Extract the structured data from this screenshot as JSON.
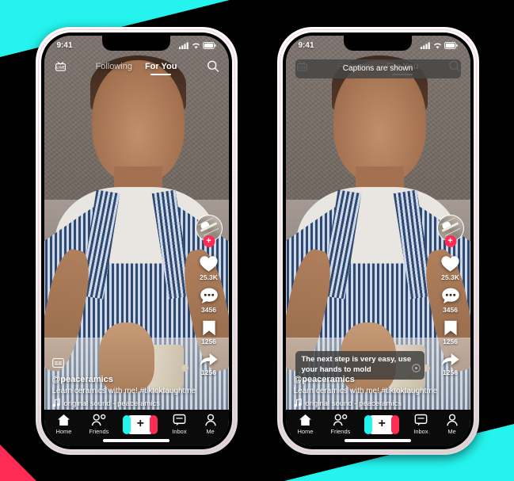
{
  "brand": {
    "cyan": "#25F4EE",
    "pink": "#FE2C55",
    "background": "#000000"
  },
  "phones": [
    {
      "id": "phone-left",
      "status_bar": {
        "time": "9:41",
        "signal_icon": "cellular-signal-icon",
        "wifi_icon": "wifi-icon",
        "battery_icon": "battery-icon"
      },
      "header": {
        "live_label": "LIVE",
        "tabs": [
          {
            "label": "Following",
            "active": false
          },
          {
            "label": "For You",
            "active": true
          }
        ],
        "search_icon": "search-icon"
      },
      "toast": {
        "visible": false,
        "text": ""
      },
      "caption_overlay": {
        "visible": false,
        "text": ""
      },
      "actions": {
        "avatar_name": "creator-avatar",
        "follow_badge": "+",
        "items": [
          {
            "icon": "heart-icon",
            "count": "25.3K"
          },
          {
            "icon": "comment-icon",
            "count": "3456"
          },
          {
            "icon": "bookmark-icon",
            "count": "1256"
          },
          {
            "icon": "share-icon",
            "count": "1256"
          }
        ]
      },
      "info": {
        "cc_icon": "closed-caption-icon",
        "handle": "@peaceramics",
        "description": "Learn ceramics with me! #tiktoktaughtme",
        "music_icon": "music-note-icon",
        "music": "original sound - peaceramics"
      },
      "tabbar": [
        {
          "icon": "home-icon",
          "label": "Home"
        },
        {
          "icon": "friends-icon",
          "label": "Friends"
        },
        {
          "icon": "create-plus-icon",
          "label": "+"
        },
        {
          "icon": "inbox-icon",
          "label": "Inbox"
        },
        {
          "icon": "profile-icon",
          "label": "Me"
        }
      ]
    },
    {
      "id": "phone-right",
      "status_bar": {
        "time": "9:41",
        "signal_icon": "cellular-signal-icon",
        "wifi_icon": "wifi-icon",
        "battery_icon": "battery-icon"
      },
      "header": {
        "live_label": "LIVE",
        "tabs": [
          {
            "label": "Following",
            "active": false
          },
          {
            "label": "For You",
            "active": true
          }
        ],
        "search_icon": "search-icon"
      },
      "toast": {
        "visible": true,
        "text": "Captions are shown"
      },
      "caption_overlay": {
        "visible": true,
        "text": "The next step is very easy, use your hands to mold"
      },
      "actions": {
        "avatar_name": "creator-avatar",
        "follow_badge": "+",
        "items": [
          {
            "icon": "heart-icon",
            "count": "25.3K"
          },
          {
            "icon": "comment-icon",
            "count": "3456"
          },
          {
            "icon": "bookmark-icon",
            "count": "1256"
          },
          {
            "icon": "share-icon",
            "count": "1256"
          }
        ]
      },
      "info": {
        "cc_icon": "closed-caption-icon",
        "handle": "@peaceramics",
        "description": "Learn ceramics with me! #tiktoktaughtme",
        "music_icon": "music-note-icon",
        "music": "original sound - peaceramics"
      },
      "tabbar": [
        {
          "icon": "home-icon",
          "label": "Home"
        },
        {
          "icon": "friends-icon",
          "label": "Friends"
        },
        {
          "icon": "create-plus-icon",
          "label": "+"
        },
        {
          "icon": "inbox-icon",
          "label": "Inbox"
        },
        {
          "icon": "profile-icon",
          "label": "Me"
        }
      ]
    }
  ]
}
